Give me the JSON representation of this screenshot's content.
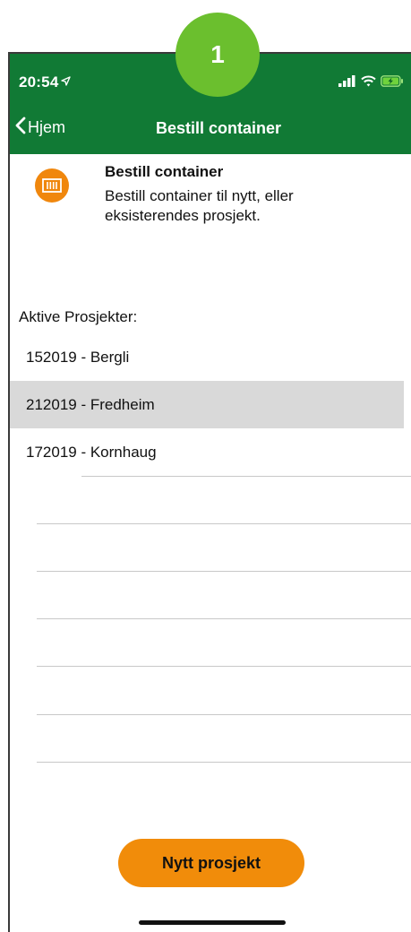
{
  "step_badge": "1",
  "status_bar": {
    "time": "20:54"
  },
  "nav": {
    "back_label": "Hjem",
    "title": "Bestill container"
  },
  "info_card": {
    "title": "Bestill container",
    "description": "Bestill container til nytt, eller eksisterendes prosjekt."
  },
  "projects": {
    "label": "Aktive Prosjekter:",
    "items": [
      {
        "label": "152019 - Bergli"
      },
      {
        "label": "212019 - Fredheim"
      },
      {
        "label": "172019 - Kornhaug"
      }
    ],
    "selected_index": 1
  },
  "actions": {
    "new_project_label": "Nytt prosjekt"
  },
  "colors": {
    "header_green": "#117a35",
    "accent_orange": "#f18c0a",
    "badge_green": "#6bbf2e",
    "selected_row": "#d9d9d9"
  }
}
